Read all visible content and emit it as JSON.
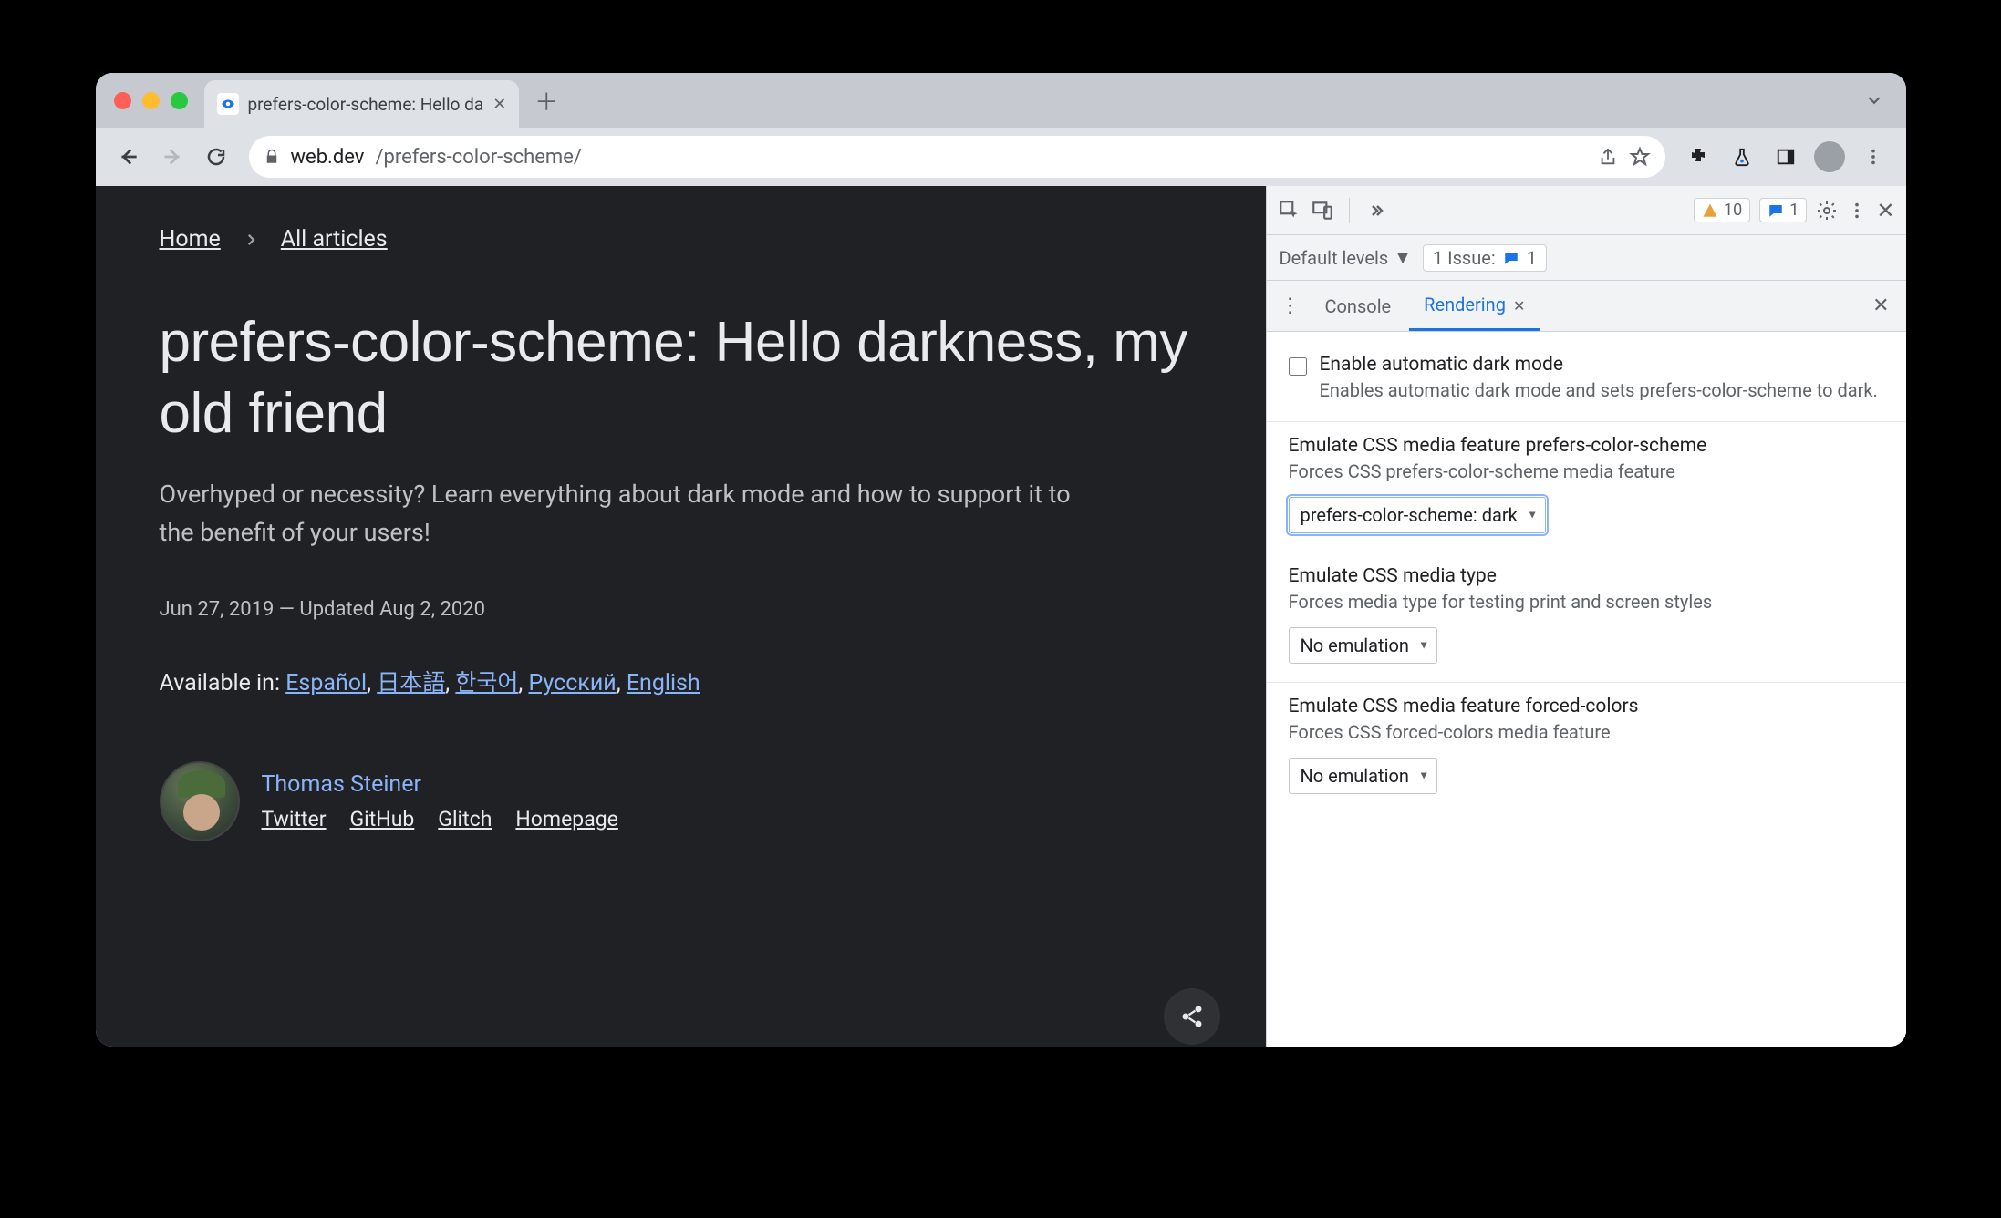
{
  "browser": {
    "tab_title": "prefers-color-scheme: Hello da",
    "url_host": "web.dev",
    "url_path": "/prefers-color-scheme/"
  },
  "page": {
    "breadcrumb": {
      "home": "Home",
      "all": "All articles"
    },
    "title": "prefers-color-scheme: Hello darkness, my old friend",
    "subtitle": "Overhyped or necessity? Learn everything about dark mode and how to support it to the benefit of your users!",
    "dates": "Jun 27, 2019 — Updated Aug 2, 2020",
    "available_label": "Available in:",
    "langs": [
      "Español",
      "日本語",
      "한국어",
      "Русский",
      "English"
    ],
    "author": {
      "name": "Thomas Steiner",
      "links": [
        "Twitter",
        "GitHub",
        "Glitch",
        "Homepage"
      ]
    }
  },
  "devtools": {
    "warn_count": "10",
    "info_count": "1",
    "levels_label": "Default levels",
    "issue_label": "1 Issue:",
    "issue_count": "1",
    "tabs": {
      "console": "Console",
      "rendering": "Rendering"
    },
    "sections": {
      "darkmode": {
        "title": "Enable automatic dark mode",
        "desc": "Enables automatic dark mode and sets prefers-color-scheme to dark."
      },
      "pcs": {
        "title": "Emulate CSS media feature prefers-color-scheme",
        "desc": "Forces CSS prefers-color-scheme media feature",
        "value": "prefers-color-scheme: dark"
      },
      "mediatype": {
        "title": "Emulate CSS media type",
        "desc": "Forces media type for testing print and screen styles",
        "value": "No emulation"
      },
      "forced": {
        "title": "Emulate CSS media feature forced-colors",
        "desc": "Forces CSS forced-colors media feature",
        "value": "No emulation"
      }
    }
  }
}
